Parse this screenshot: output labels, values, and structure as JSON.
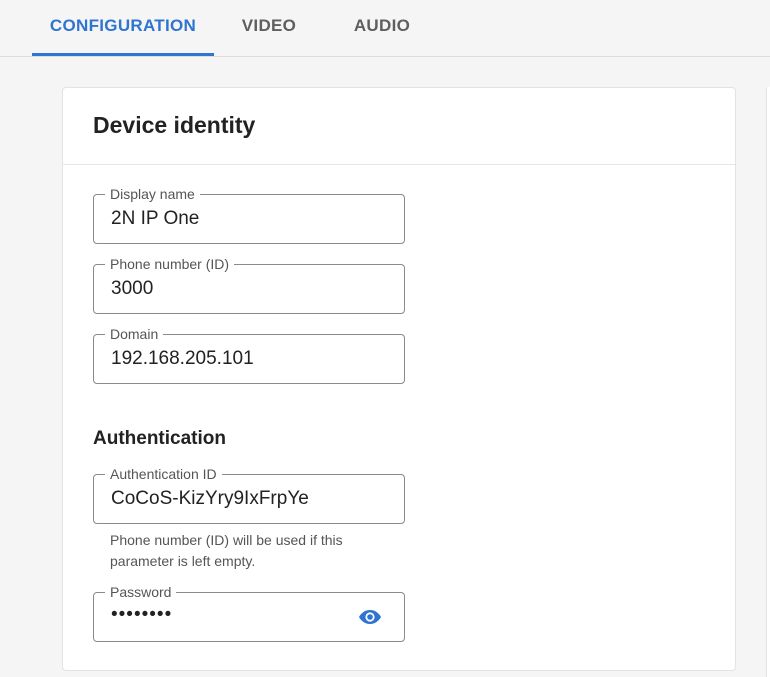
{
  "tabs": [
    {
      "label": "CONFIGURATION",
      "active": true
    },
    {
      "label": "VIDEO",
      "active": false
    },
    {
      "label": "AUDIO",
      "active": false
    }
  ],
  "card": {
    "title": "Device identity"
  },
  "fields": {
    "display_name": {
      "label": "Display name",
      "value": "2N IP One"
    },
    "phone_number": {
      "label": "Phone number (ID)",
      "value": "3000"
    },
    "domain": {
      "label": "Domain",
      "value": "192.168.205.101"
    }
  },
  "authentication": {
    "title": "Authentication",
    "auth_id": {
      "label": "Authentication ID",
      "value": "CoCoS-KizYry9IxFrpYe"
    },
    "helper": "Phone number (ID) will be used if this parameter is left empty.",
    "password": {
      "label": "Password",
      "value": "••••••••",
      "icon": "eye-icon"
    }
  },
  "colors": {
    "accent": "#2f74d0",
    "background": "#f5f5f5",
    "card": "#ffffff"
  }
}
